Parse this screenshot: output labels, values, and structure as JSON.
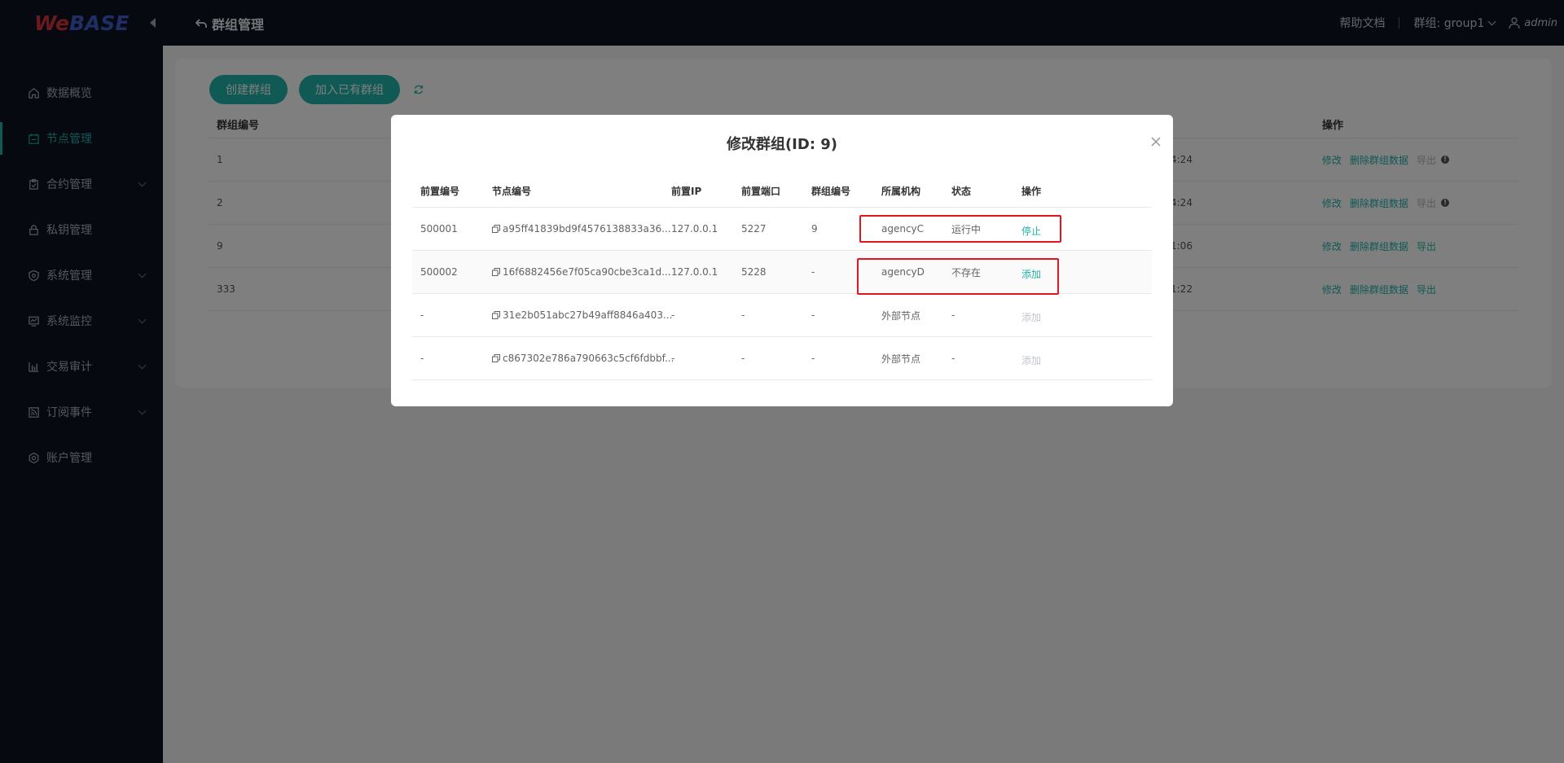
{
  "app": {
    "logo_we": "We",
    "logo_base": "BASE"
  },
  "header": {
    "title": "群组管理",
    "help": "帮助文档",
    "group_select": "群组: group1",
    "user": "admin"
  },
  "sidebar": {
    "items": [
      {
        "label": "数据概览",
        "icon": "home-icon"
      },
      {
        "label": "节点管理",
        "icon": "calendar-icon",
        "active": true
      },
      {
        "label": "合约管理",
        "icon": "clipboard-icon"
      },
      {
        "label": "私钥管理",
        "icon": "lock-icon"
      },
      {
        "label": "系统管理",
        "icon": "shield-icon"
      },
      {
        "label": "系统监控",
        "icon": "monitor-icon"
      },
      {
        "label": "交易审计",
        "icon": "bar-chart-icon"
      },
      {
        "label": "订阅事件",
        "icon": "rss-icon"
      },
      {
        "label": "账户管理",
        "icon": "gear-icon"
      }
    ]
  },
  "toolbar": {
    "create_group": "创建群组",
    "join_group": "加入已有群组"
  },
  "bg_table": {
    "headers": {
      "group_id": "群组编号",
      "ops": "操作"
    },
    "rows": [
      {
        "id": "1",
        "time": "4:24",
        "edit": "修改",
        "delete": "删除群组数据",
        "export": "导出"
      },
      {
        "id": "2",
        "time": "4:24",
        "edit": "修改",
        "delete": "删除群组数据",
        "export": "导出"
      },
      {
        "id": "9",
        "time": "1:06",
        "edit": "修改",
        "delete": "删除群组数据",
        "export": "导出"
      },
      {
        "id": "333",
        "time": "1:22",
        "edit": "修改",
        "delete": "删除群组数据",
        "export": "导出"
      }
    ]
  },
  "modal": {
    "title": "修改群组(ID: 9)",
    "headers": {
      "front_id": "前置编号",
      "node_id": "节点编号",
      "front_ip": "前置IP",
      "front_port": "前置端口",
      "group_id": "群组编号",
      "agency": "所属机构",
      "status": "状态",
      "action": "操作"
    },
    "rows": [
      {
        "front_id": "500001",
        "node_id": "a95ff41839bd9f4576138833a36...",
        "ip": "127.0.0.1",
        "port": "5227",
        "group": "9",
        "agency": "agencyC",
        "status": "运行中",
        "action": "停止"
      },
      {
        "front_id": "500002",
        "node_id": "16f6882456e7f05ca90cbe3ca1d...",
        "ip": "127.0.0.1",
        "port": "5228",
        "group": "-",
        "agency": "agencyD",
        "status": "不存在",
        "action": "添加"
      },
      {
        "front_id": "-",
        "node_id": "31e2b051abc27b49aff8846a403...",
        "ip": "-",
        "port": "-",
        "group": "-",
        "agency": "外部节点",
        "status": "-",
        "action": "添加"
      },
      {
        "front_id": "-",
        "node_id": "c867302e786a790663c5cf6fdbbf...",
        "ip": "-",
        "port": "-",
        "group": "-",
        "agency": "外部节点",
        "status": "-",
        "action": "添加"
      }
    ]
  }
}
